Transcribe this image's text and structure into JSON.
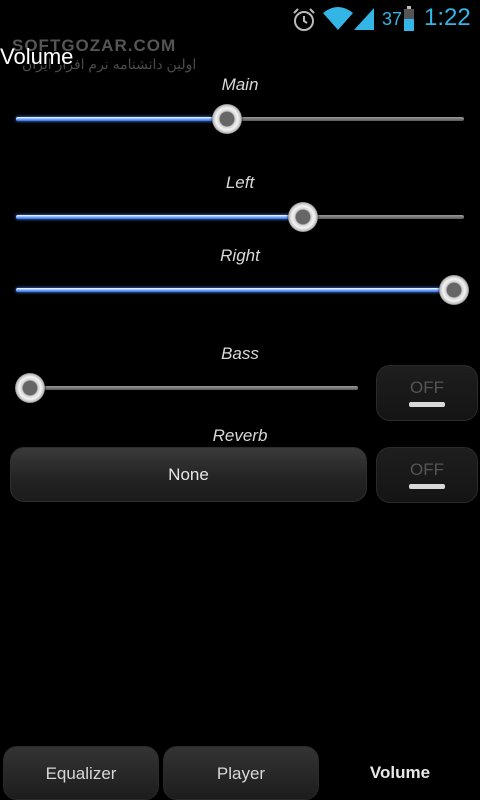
{
  "status_bar": {
    "battery_percent": "37",
    "time": "1:22",
    "icons": [
      "alarm-icon",
      "wifi-icon",
      "signal-icon",
      "battery-icon"
    ],
    "accent_color": "#33b5e5"
  },
  "watermark": {
    "logo": "SOFTGOZAR.COM",
    "tagline": "اولین دانشنامه نرم افزار ایران"
  },
  "page": {
    "title": "Volume"
  },
  "sliders": {
    "main": {
      "label": "Main",
      "value": 0.47
    },
    "left": {
      "label": "Left",
      "value": 0.64
    },
    "right": {
      "label": "Right",
      "value": 1.0
    },
    "bass": {
      "label": "Bass",
      "value": 0.0
    }
  },
  "bass_toggle": {
    "label": "OFF",
    "state": "off"
  },
  "reverb": {
    "label": "Reverb",
    "preset": "None",
    "toggle_label": "OFF",
    "state": "off"
  },
  "tabs": [
    {
      "label": "Equalizer",
      "active": false
    },
    {
      "label": "Player",
      "active": false
    },
    {
      "label": "Volume",
      "active": true
    }
  ],
  "colors": {
    "slider_fill": "#4a8cff",
    "background": "#000000"
  }
}
